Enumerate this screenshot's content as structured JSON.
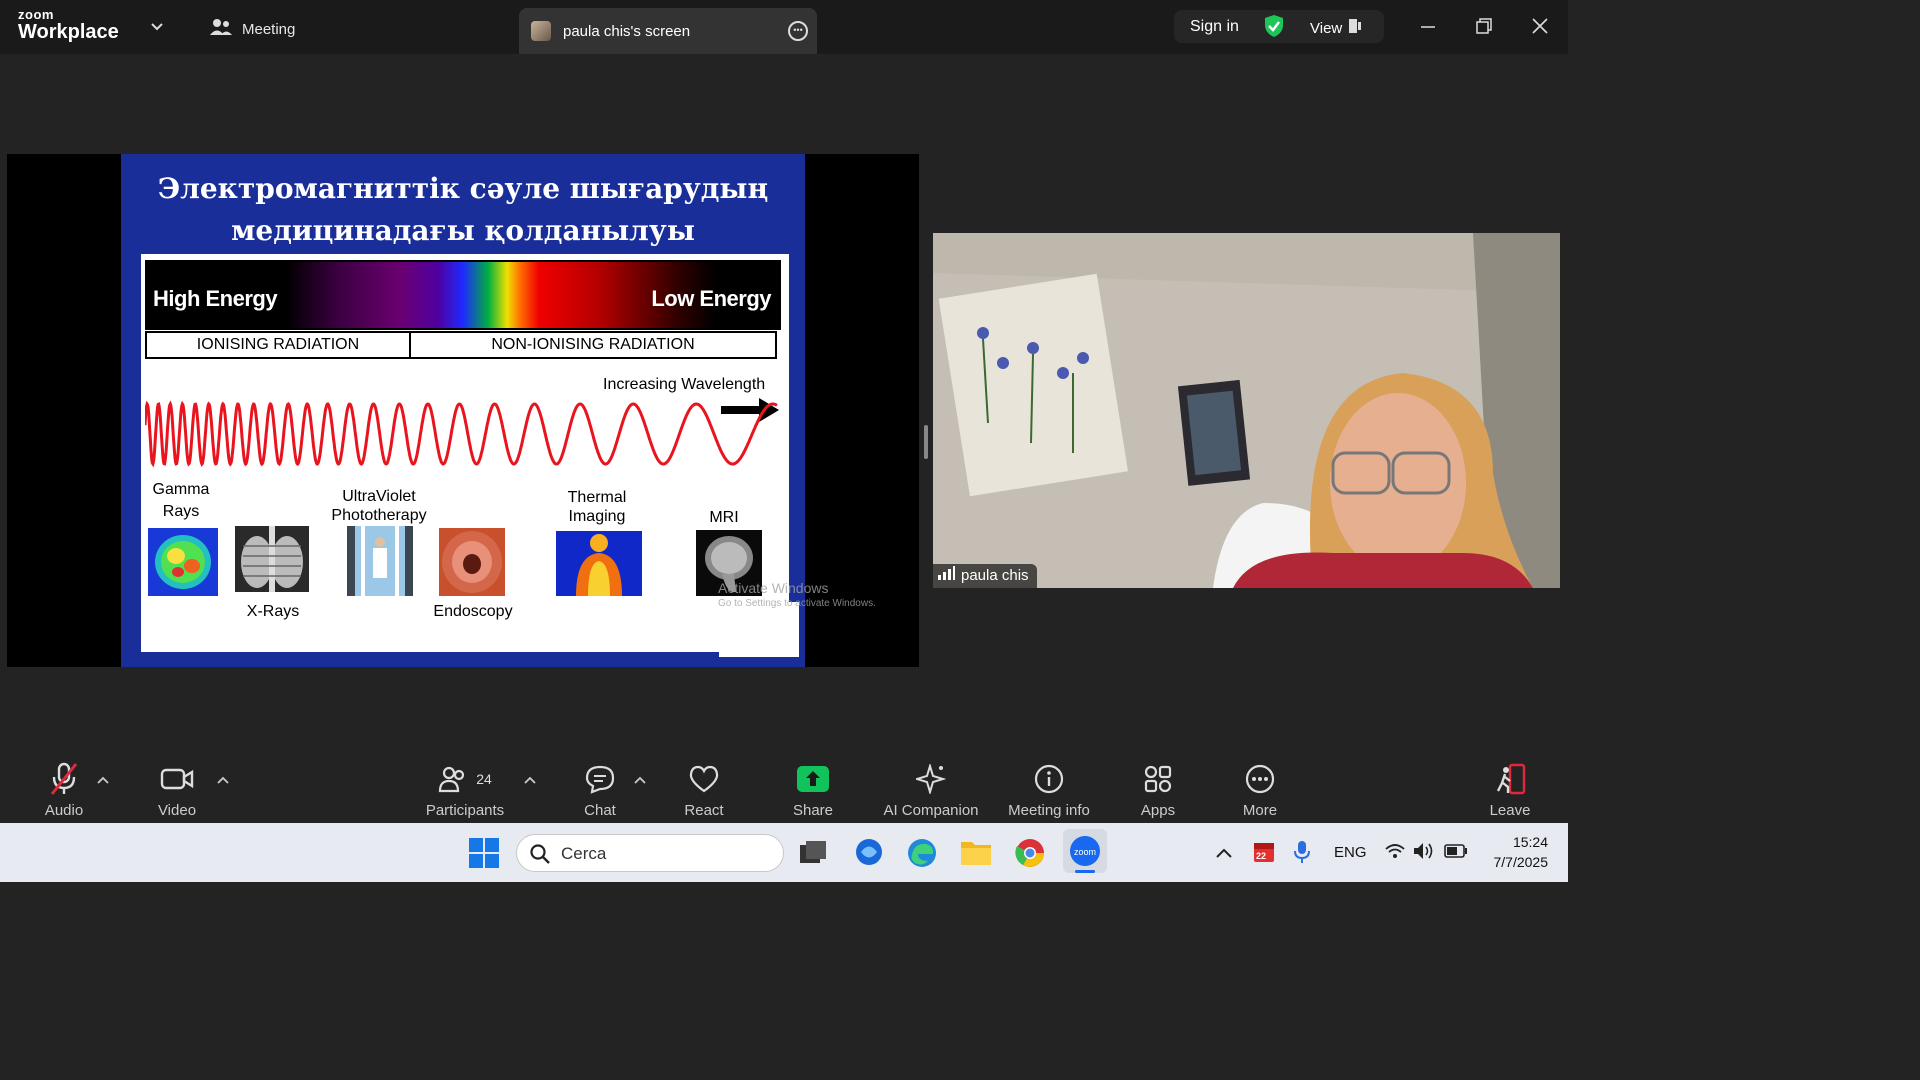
{
  "titlebar": {
    "logo_top": "zoom",
    "logo_bottom": "Workplace",
    "meeting_label": "Meeting",
    "screen_tab_label": "paula chis's screen",
    "sign_in": "Sign in",
    "view": "View"
  },
  "slide": {
    "title_line1": "Электромагниттік сәуле шығарудың",
    "title_line2": "медицинадағы қолданылуы",
    "high_energy": "High Energy",
    "low_energy": "Low Energy",
    "ionising": "IONISING RADIATION",
    "non_ionising": "NON-IONISING RADIATION",
    "increasing_wavelength": "Increasing  Wavelength",
    "labels": {
      "gamma1": "Gamma",
      "gamma2": "Rays",
      "xrays": "X-Rays",
      "uv1": "UltraViolet",
      "uv2": "Phototherapy",
      "endoscopy": "Endoscopy",
      "thermal1": "Thermal",
      "thermal2": "Imaging",
      "mri": "MRI"
    }
  },
  "watermark": {
    "line1": "Activate Windows",
    "line2": "Go to Settings to activate Windows."
  },
  "video": {
    "participant_name": "paula chis"
  },
  "toolbar": {
    "audio": "Audio",
    "video": "Video",
    "participants": "Participants",
    "participants_count": "24",
    "chat": "Chat",
    "react": "React",
    "share": "Share",
    "ai_companion": "AI Companion",
    "meeting_info": "Meeting info",
    "apps": "Apps",
    "more": "More",
    "leave": "Leave"
  },
  "taskbar": {
    "search_placeholder": "Cerca",
    "language": "ENG",
    "time": "15:24",
    "date": "7/7/2025",
    "calendar_badge": "22"
  },
  "colors": {
    "accent_green": "#12c25a",
    "leave_red": "#e02a3c",
    "shield_green": "#1ec65a"
  }
}
